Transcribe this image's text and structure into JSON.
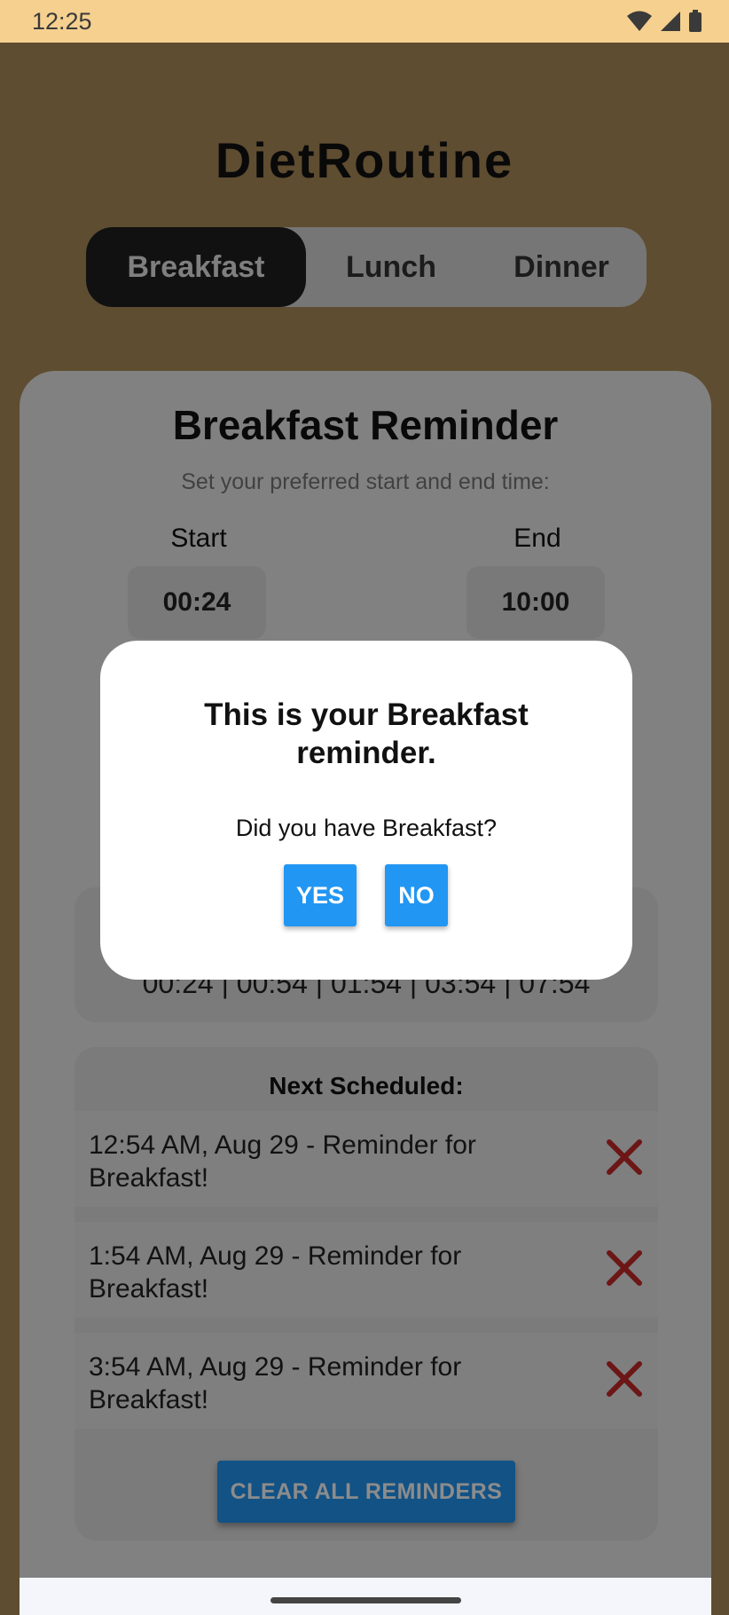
{
  "status_bar": {
    "time": "12:25"
  },
  "app": {
    "title": "DietRoutine"
  },
  "tabs": [
    {
      "label": "Breakfast",
      "active": true
    },
    {
      "label": "Lunch",
      "active": false
    },
    {
      "label": "Dinner",
      "active": false
    }
  ],
  "reminder": {
    "title": "Breakfast Reminder",
    "subtitle": "Set your preferred start and end time:",
    "start_label": "Start",
    "start_value": "00:24",
    "end_label": "End",
    "end_value": "10:00"
  },
  "schedule": {
    "times": "00:24 | 00:54 | 01:54 | 03:54 | 07:54"
  },
  "next": {
    "title": "Next Scheduled:",
    "items": [
      {
        "text": "12:54 AM, Aug 29 - Reminder for Breakfast!"
      },
      {
        "text": "1:54 AM, Aug 29 - Reminder for Breakfast!"
      },
      {
        "text": "3:54 AM, Aug 29 - Reminder for Breakfast!"
      }
    ],
    "clear_label": "CLEAR ALL REMINDERS"
  },
  "dialog": {
    "title": "This is your Breakfast reminder.",
    "message": "Did you have Breakfast?",
    "yes_label": "YES",
    "no_label": "NO"
  },
  "colors": {
    "accent": "#2196f3",
    "delete": "#c62828",
    "background": "#ad8c5a",
    "status_bar": "#f5d08f"
  }
}
